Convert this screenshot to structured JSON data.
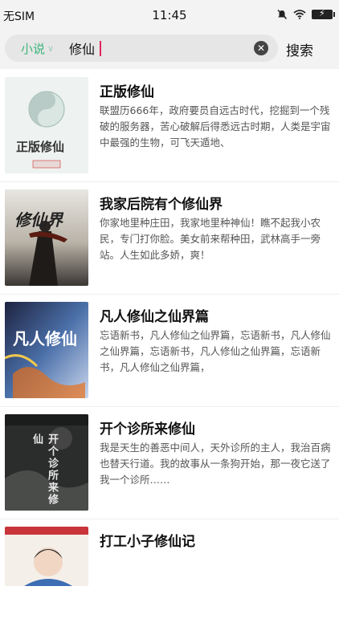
{
  "status": {
    "carrier": "无SIM",
    "time": "11:45",
    "icons": [
      "silent-icon",
      "wifi-icon",
      "battery-charging-icon"
    ]
  },
  "search": {
    "scope": "小说",
    "query": "修仙",
    "search_label": "搜索",
    "accent": "#3bb37a"
  },
  "books": [
    {
      "title": "正版修仙",
      "description": "联盟历666年，政府要员自远古时代，挖掘到一个残破的服务器，苦心破解后得悉远古时期，人类是宇宙中最强的生物，可飞天遁地、",
      "cover_title": "正版修仙"
    },
    {
      "title": "我家后院有个修仙界",
      "description": "你家地里种庄田，我家地里种神仙！瞧不起我小农民，专门打你脸。美女前来帮种田，武林高手一旁站。人生如此多娇，爽！",
      "cover_title": "修仙界"
    },
    {
      "title": "凡人修仙之仙界篇",
      "description": "忘语新书，凡人修仙之仙界篇，忘语新书，凡人修仙之仙界篇，忘语新书，凡人修仙之仙界篇，忘语新书，凡人修仙之仙界篇，",
      "cover_title": "凡人修仙"
    },
    {
      "title": "开个诊所来修仙",
      "description": "我是天生的善恶中间人，天外诊所的主人，我治百病也替天行道。我的故事从一条狗开始，那一夜它送了我一个诊所……",
      "cover_title": "开个诊所来修仙"
    },
    {
      "title": "打工小子修仙记",
      "description": "",
      "cover_title": ""
    }
  ]
}
